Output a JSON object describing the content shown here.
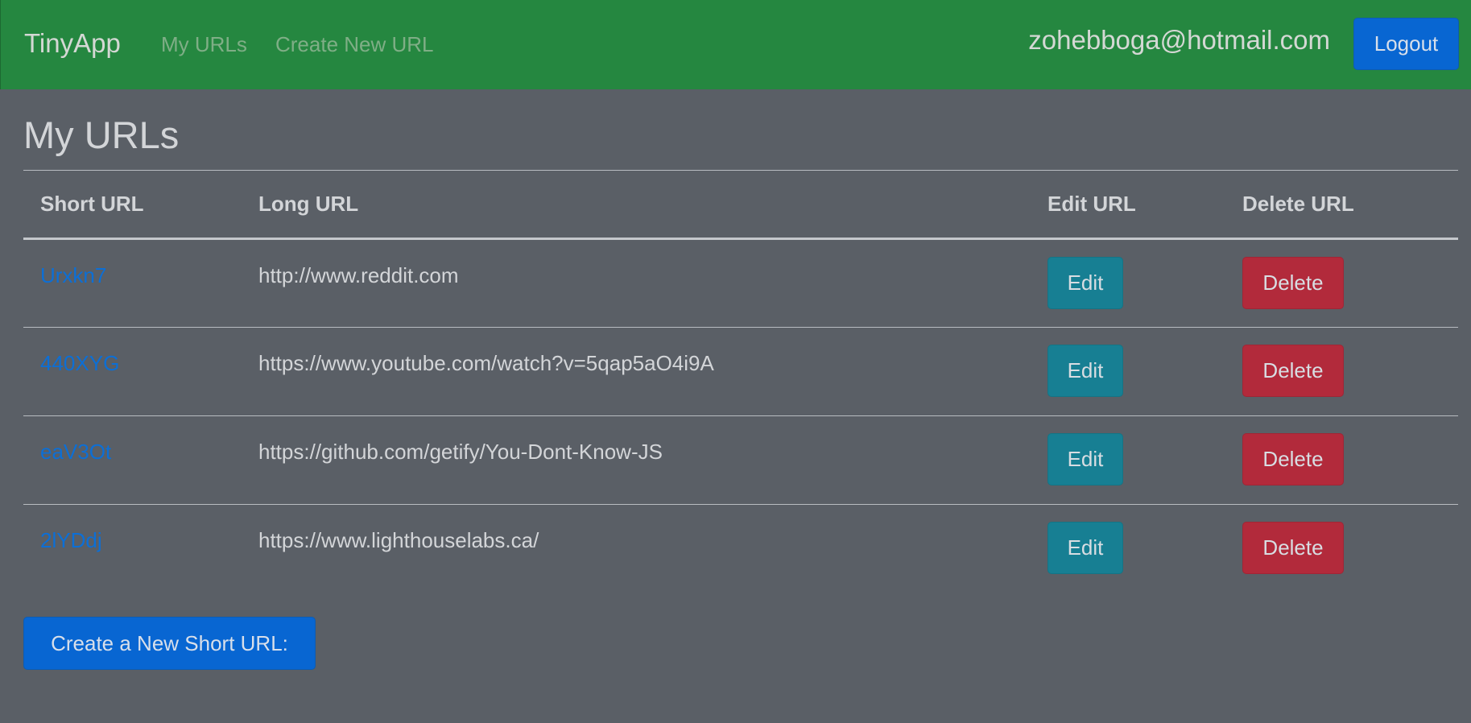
{
  "navbar": {
    "brand": "TinyApp",
    "links": [
      "My URLs",
      "Create New URL"
    ],
    "user_email": "zohebboga@hotmail.com",
    "logout_label": "Logout"
  },
  "main": {
    "title": "My URLs",
    "table": {
      "headers": [
        "Short URL",
        "Long URL",
        "Edit URL",
        "Delete URL"
      ],
      "rows": [
        {
          "short": "Urxkn7",
          "long": "http://www.reddit.com",
          "edit": "Edit",
          "delete": "Delete"
        },
        {
          "short": "440XYG",
          "long": "https://www.youtube.com/watch?v=5qap5aO4i9A",
          "edit": "Edit",
          "delete": "Delete"
        },
        {
          "short": "eaV3Ot",
          "long": "https://github.com/getify/You-Dont-Know-JS",
          "edit": "Edit",
          "delete": "Delete"
        },
        {
          "short": "2lYDdj",
          "long": "https://www.lighthouselabs.ca/",
          "edit": "Edit",
          "delete": "Delete"
        }
      ]
    },
    "create_button_label": "Create a New Short URL:"
  },
  "colors": {
    "navbar": "#258740",
    "background": "#5a5f66",
    "primary": "#0866d2",
    "edit": "#177f93",
    "delete": "#b22a3b",
    "link": "#0c6fd6"
  }
}
